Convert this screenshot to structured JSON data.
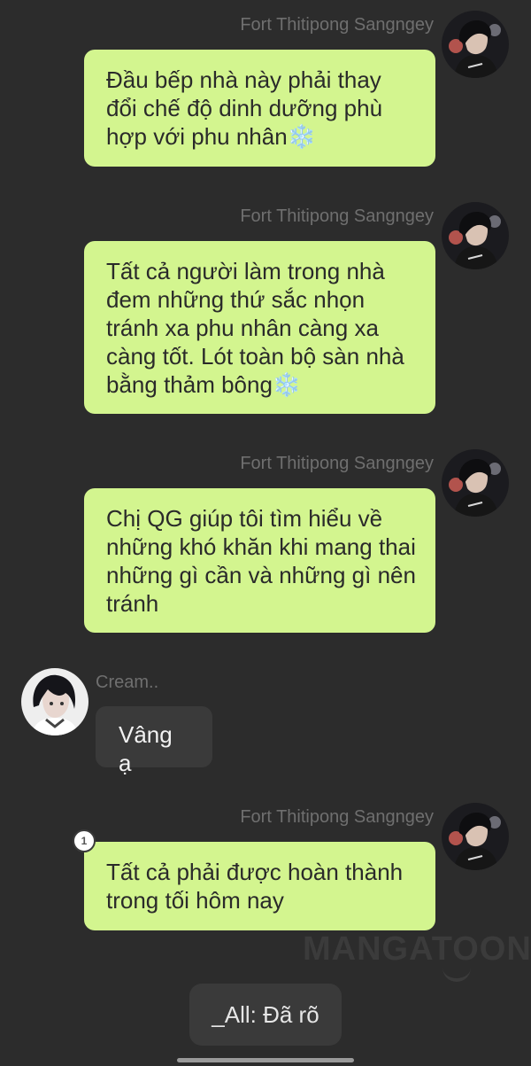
{
  "messages": [
    {
      "sender": "Fort Thitipong Sangngey",
      "text": "Đầu bếp nhà này phải thay đổi chế độ dinh dưỡng phù hợp với phu nhân❄️"
    },
    {
      "sender": "Fort Thitipong Sangngey",
      "text": "Tất cả người làm trong nhà đem những thứ sắc nhọn tránh xa phu nhân càng xa càng tốt. Lót toàn bộ sàn nhà bằng thảm bông❄️"
    },
    {
      "sender": "Fort Thitipong Sangngey",
      "text": "Chị QG giúp tôi tìm hiểu về những khó khăn khi mang thai những gì cần và những gì nên tránh"
    },
    {
      "sender": "Cream..",
      "text": "Vâng ạ"
    },
    {
      "sender": "Fort Thitipong Sangngey",
      "text": "Tất cả phải được hoàn thành trong tối hôm nay",
      "read_count": "1"
    }
  ],
  "system_message": "_All: Đã rõ",
  "watermark": "MANGATOON",
  "colors": {
    "background": "#2c2c2c",
    "outgoing_bubble": "#d3f58f",
    "incoming_bubble": "#3a3a3a",
    "name_text": "#6f6f6f"
  },
  "icons": {
    "avatar_right": "male-portrait-avatar",
    "avatar_left": "anime-portrait-avatar"
  }
}
